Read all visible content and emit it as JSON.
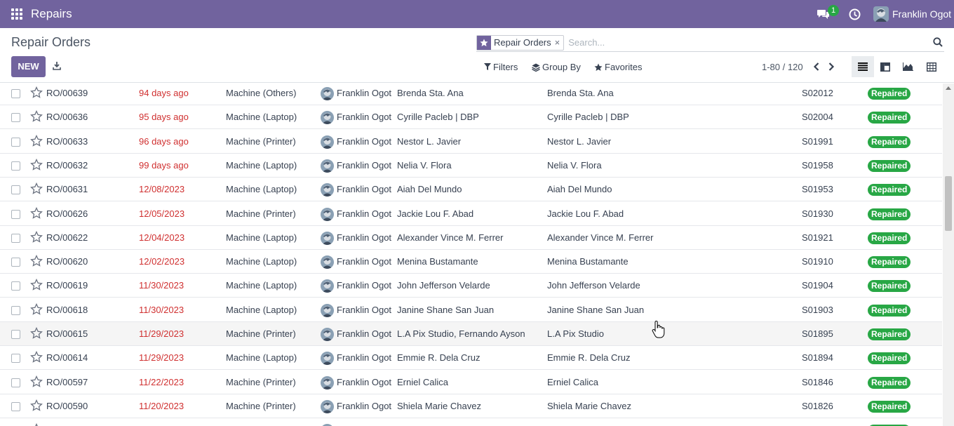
{
  "navbar": {
    "app_title": "Repairs",
    "chat_count": "1",
    "user_name": "Franklin Ogot",
    "color": "#71639e"
  },
  "control_panel": {
    "breadcrumb": "Repair Orders",
    "new_label": "NEW",
    "facet_label": "Repair Orders",
    "facet_remove": "×",
    "search_placeholder": "Search...",
    "filters_label": "Filters",
    "group_by_label": "Group By",
    "favorites_label": "Favorites",
    "pager": "1-80 / 120"
  },
  "colors": {
    "overdue_date": "#d03030",
    "status_badge": "#28a745"
  },
  "rows": [
    {
      "ref": "RO/00639",
      "date": "94 days ago",
      "product": "Machine (Others)",
      "technician": "Franklin Ogot",
      "customer": "Brenda Sta. Ana",
      "partner": "Brenda Sta. Ana",
      "sale_order": "S02012",
      "status": "Repaired"
    },
    {
      "ref": "RO/00636",
      "date": "95 days ago",
      "product": "Machine (Laptop)",
      "technician": "Franklin Ogot",
      "customer": "Cyrille Pacleb | DBP",
      "partner": "Cyrille Pacleb | DBP",
      "sale_order": "S02004",
      "status": "Repaired"
    },
    {
      "ref": "RO/00633",
      "date": "96 days ago",
      "product": "Machine (Printer)",
      "technician": "Franklin Ogot",
      "customer": "Nestor L. Javier",
      "partner": "Nestor L. Javier",
      "sale_order": "S01991",
      "status": "Repaired"
    },
    {
      "ref": "RO/00632",
      "date": "99 days ago",
      "product": "Machine (Laptop)",
      "technician": "Franklin Ogot",
      "customer": "Nelia V. Flora",
      "partner": "Nelia V. Flora",
      "sale_order": "S01958",
      "status": "Repaired"
    },
    {
      "ref": "RO/00631",
      "date": "12/08/2023",
      "product": "Machine (Laptop)",
      "technician": "Franklin Ogot",
      "customer": "Aiah Del Mundo",
      "partner": "Aiah Del Mundo",
      "sale_order": "S01953",
      "status": "Repaired"
    },
    {
      "ref": "RO/00626",
      "date": "12/05/2023",
      "product": "Machine (Printer)",
      "technician": "Franklin Ogot",
      "customer": "Jackie Lou F. Abad",
      "partner": "Jackie Lou F. Abad",
      "sale_order": "S01930",
      "status": "Repaired"
    },
    {
      "ref": "RO/00622",
      "date": "12/04/2023",
      "product": "Machine (Laptop)",
      "technician": "Franklin Ogot",
      "customer": "Alexander Vince M. Ferrer",
      "partner": "Alexander Vince M. Ferrer",
      "sale_order": "S01921",
      "status": "Repaired"
    },
    {
      "ref": "RO/00620",
      "date": "12/02/2023",
      "product": "Machine (Laptop)",
      "technician": "Franklin Ogot",
      "customer": "Menina Bustamante",
      "partner": "Menina Bustamante",
      "sale_order": "S01910",
      "status": "Repaired"
    },
    {
      "ref": "RO/00619",
      "date": "11/30/2023",
      "product": "Machine (Laptop)",
      "technician": "Franklin Ogot",
      "customer": "John Jefferson Velarde",
      "partner": "John Jefferson Velarde",
      "sale_order": "S01904",
      "status": "Repaired"
    },
    {
      "ref": "RO/00618",
      "date": "11/30/2023",
      "product": "Machine (Laptop)",
      "technician": "Franklin Ogot",
      "customer": "Janine Shane San Juan",
      "partner": "Janine Shane San Juan",
      "sale_order": "S01903",
      "status": "Repaired"
    },
    {
      "ref": "RO/00615",
      "date": "11/29/2023",
      "product": "Machine (Printer)",
      "technician": "Franklin Ogot",
      "customer": "L.A Pix Studio, Fernando Ayson",
      "partner": "L.A Pix Studio",
      "sale_order": "S01895",
      "status": "Repaired"
    },
    {
      "ref": "RO/00614",
      "date": "11/29/2023",
      "product": "Machine (Laptop)",
      "technician": "Franklin Ogot",
      "customer": "Emmie R. Dela Cruz",
      "partner": "Emmie R. Dela Cruz",
      "sale_order": "S01894",
      "status": "Repaired"
    },
    {
      "ref": "RO/00597",
      "date": "11/22/2023",
      "product": "Machine (Printer)",
      "technician": "Franklin Ogot",
      "customer": "Erniel Calica",
      "partner": "Erniel Calica",
      "sale_order": "S01846",
      "status": "Repaired"
    },
    {
      "ref": "RO/00590",
      "date": "11/20/2023",
      "product": "Machine (Printer)",
      "technician": "Franklin Ogot",
      "customer": "Shiela Marie Chavez",
      "partner": "Shiela Marie Chavez",
      "sale_order": "S01826",
      "status": "Repaired"
    },
    {
      "ref": "",
      "date": "",
      "product": "",
      "technician": "",
      "customer": "",
      "partner": "",
      "sale_order": "",
      "status": "Repaired"
    }
  ]
}
